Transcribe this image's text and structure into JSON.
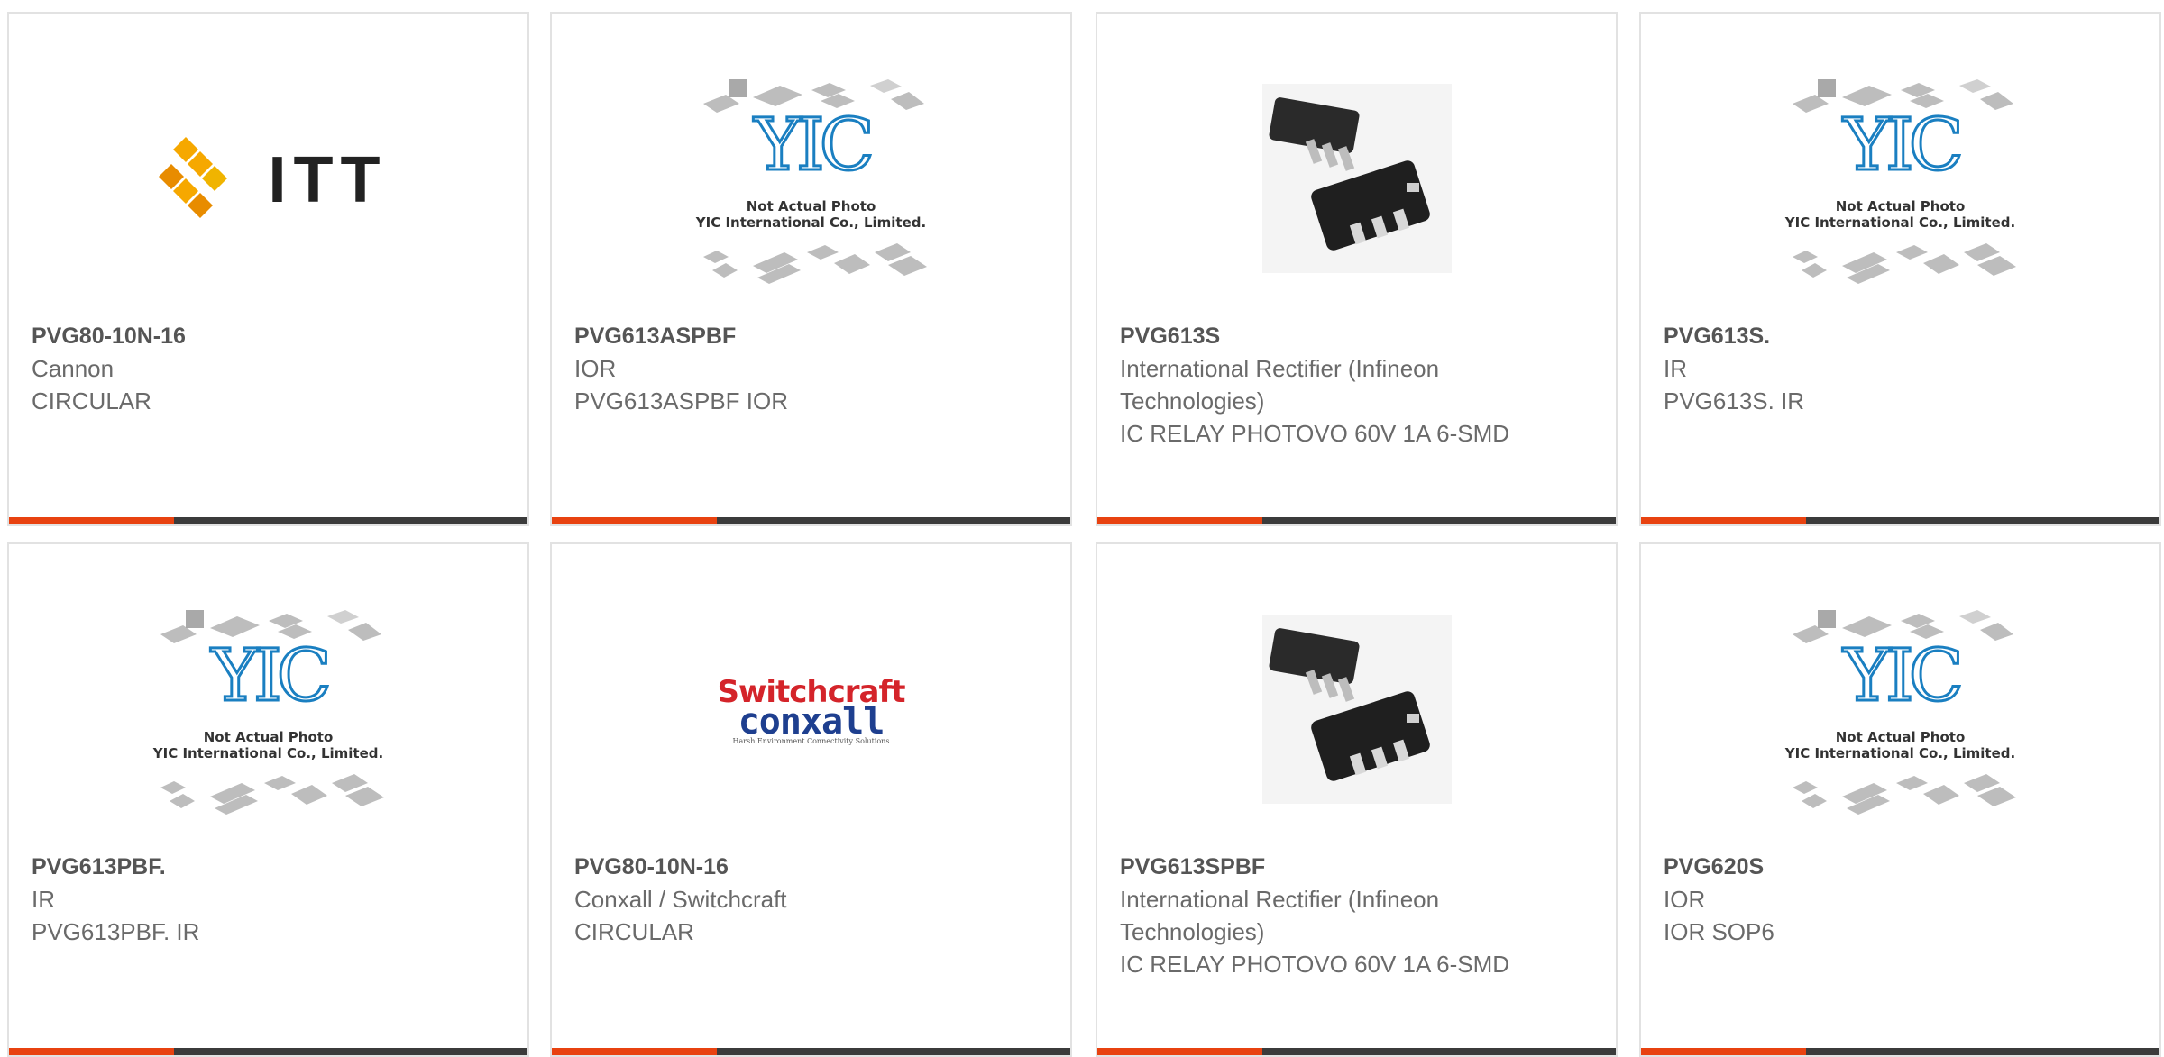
{
  "products": [
    {
      "part_number": "PVG80-10N-16",
      "manufacturer": "Cannon",
      "description": "CIRCULAR",
      "image": "itt-logo",
      "image_text": "ITT"
    },
    {
      "part_number": "PVG613ASPBF",
      "manufacturer": "IOR",
      "description": "PVG613ASPBF IOR",
      "image": "yic-placeholder",
      "image_text": "YIC",
      "caption_line1": "Not Actual Photo",
      "caption_line2": "YIC International Co., Limited."
    },
    {
      "part_number": "PVG613S",
      "manufacturer": "International Rectifier (Infineon Technologies)",
      "description": "IC RELAY PHOTOVO 60V 1A 6-SMD",
      "image": "smd6-chip-photo"
    },
    {
      "part_number": "PVG613S.",
      "manufacturer": "IR",
      "description": "PVG613S. IR",
      "image": "yic-placeholder",
      "image_text": "YIC",
      "caption_line1": "Not Actual Photo",
      "caption_line2": "YIC International Co., Limited."
    },
    {
      "part_number": "PVG613PBF.",
      "manufacturer": "IR",
      "description": "PVG613PBF. IR",
      "image": "yic-placeholder",
      "image_text": "YIC",
      "caption_line1": "Not Actual Photo",
      "caption_line2": "YIC International Co., Limited."
    },
    {
      "part_number": "PVG80-10N-16",
      "manufacturer": "Conxall / Switchcraft",
      "description": "CIRCULAR",
      "image": "switchcraft-logo",
      "image_text": "Switchcraft",
      "image_text2": "conxall",
      "image_text3": "Harsh Environment Connectivity Solutions"
    },
    {
      "part_number": "PVG613SPBF",
      "manufacturer": "International Rectifier (Infineon Technologies)",
      "description": "IC RELAY PHOTOVO 60V 1A 6-SMD",
      "image": "smd6-chip-photo"
    },
    {
      "part_number": "PVG620S",
      "manufacturer": "IOR",
      "description": "IOR SOP6",
      "image": "yic-placeholder",
      "image_text": "YIC",
      "caption_line1": "Not Actual Photo",
      "caption_line2": "YIC International Co., Limited."
    }
  ],
  "colors": {
    "accent": "#e84210",
    "bar": "#3b3b3b",
    "border": "#e2e2e2",
    "yic_blue": "#1a7fc1"
  }
}
